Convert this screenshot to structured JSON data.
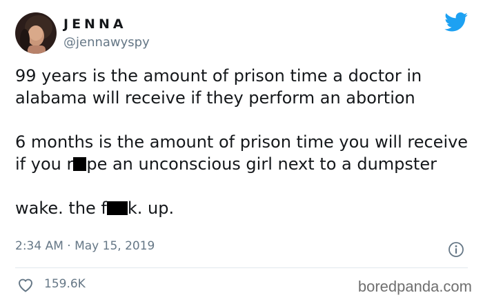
{
  "author": {
    "display_name": "JENNA",
    "handle": "@jennawyspy"
  },
  "tweet": {
    "para1": "99 years is the amount of prison time a doctor in alabama will receive if they perform an abortion",
    "para2_a": "6 months is the amount of prison time you will receive if you r",
    "para2_b": "pe an unconscious girl next to a dumpster",
    "para3_a": "wake. the f",
    "para3_b": "k. up.",
    "timestamp": "2:34 AM · May 15, 2019"
  },
  "engagement": {
    "like_count": "159.6K"
  },
  "watermark": "boredpanda.com",
  "icons": {
    "brand": "twitter-bird-icon",
    "info": "info-icon",
    "like": "heart-icon"
  },
  "colors": {
    "twitter_blue": "#1da1f2",
    "secondary_text": "#657786",
    "primary_text": "#14171a"
  }
}
